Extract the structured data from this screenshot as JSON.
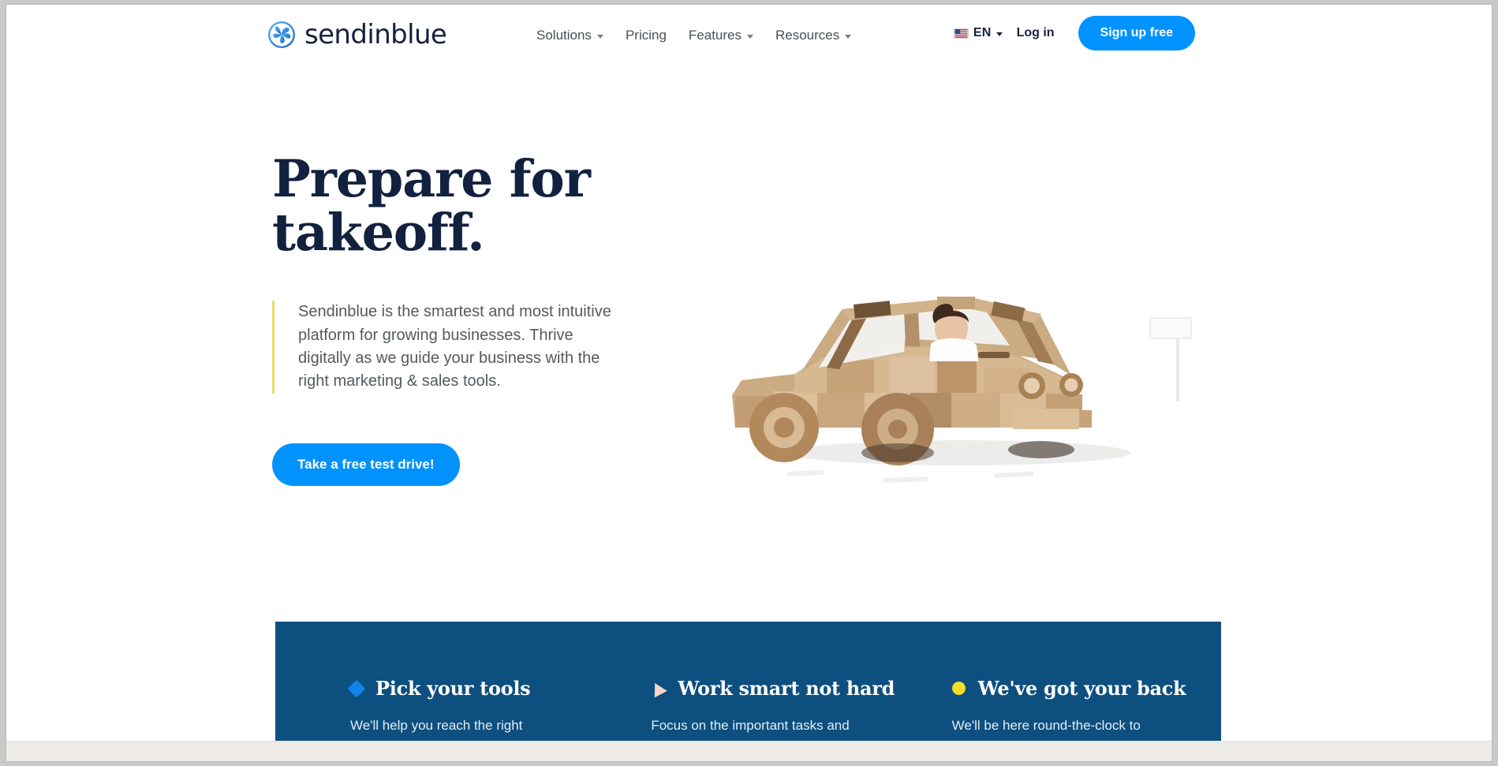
{
  "header": {
    "logo": {
      "icon": "sendinblue-pinwheel-logo-icon",
      "wordmark": "sendinblue"
    },
    "nav": [
      {
        "label": "Solutions",
        "has_dropdown": true
      },
      {
        "label": "Pricing",
        "has_dropdown": false
      },
      {
        "label": "Features",
        "has_dropdown": true
      },
      {
        "label": "Resources",
        "has_dropdown": true
      }
    ],
    "language": {
      "flag": "us-flag-icon",
      "label": "EN"
    },
    "login_label": "Log in",
    "signup_label": "Sign up free"
  },
  "hero": {
    "title": "Prepare for\ntakeoff.",
    "paragraph": "Sendinblue is the smartest and most intuitive platform for growing businesses. Thrive digitally as we guide your business with the right marketing & sales tools.",
    "cta_label": "Take a free test drive!",
    "image_alt": "wooden-block-toy-car-with-driver"
  },
  "features": [
    {
      "icon": "blue-diamond-icon",
      "title": "Pick your tools",
      "body": "We'll help you reach the right people and produce the right"
    },
    {
      "icon": "pink-triangle-icon",
      "title": "Work smart not hard",
      "body": "Focus on the important tasks and put the rest on autopilot with"
    },
    {
      "icon": "yellow-circle-icon",
      "title": "We've got your back",
      "body": "We'll be here round-the-clock to support you with any questions"
    }
  ],
  "colors": {
    "brand_blue": "#0092ff",
    "panel_blue": "#0d4f7f",
    "navy_text": "#11213f",
    "accent_yellow": "#e4e163",
    "diamond_blue": "#1383ea",
    "triangle_pink": "#f7d5cc",
    "circle_yellow": "#f5dc29"
  }
}
